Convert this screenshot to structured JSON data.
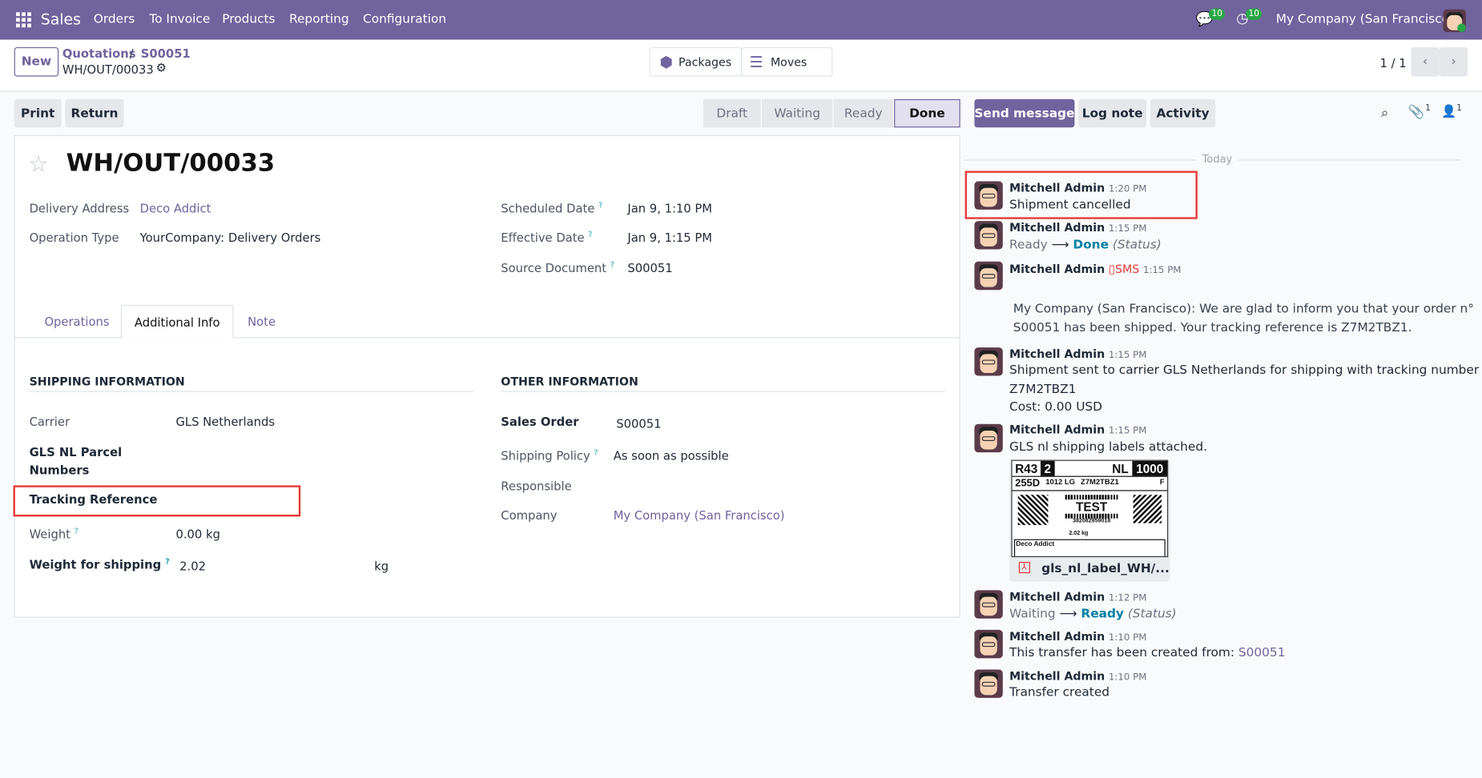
{
  "navbar": {
    "app": "Sales",
    "menu": [
      "Orders",
      "To Invoice",
      "Products",
      "Reporting",
      "Configuration"
    ],
    "messages_count": "10",
    "activities_count": "10",
    "company": "My Company (San Francisco)"
  },
  "control_panel": {
    "new_label": "New",
    "breadcrumb": [
      "Quotations",
      "S00051"
    ],
    "record": "WH/OUT/00033",
    "smart_buttons": [
      "Packages",
      "Moves"
    ],
    "pager": "1 / 1"
  },
  "actions": {
    "print": "Print",
    "return": "Return"
  },
  "statusbar": {
    "stages": [
      "Draft",
      "Waiting",
      "Ready",
      "Done"
    ],
    "active": "Done"
  },
  "chatter_buttons": {
    "send": "Send message",
    "log": "Log note",
    "activity": "Activity",
    "attachments": "1",
    "followers": "1"
  },
  "form": {
    "title": "WH/OUT/00033",
    "left": [
      {
        "label": "Delivery Address",
        "value": "Deco Addict"
      },
      {
        "label": "Operation Type",
        "value": "YourCompany: Delivery Orders"
      }
    ],
    "right": [
      {
        "label": "Scheduled Date",
        "value": "Jan 9, 1:10 PM"
      },
      {
        "label": "Effective Date",
        "value": "Jan 9, 1:15 PM"
      },
      {
        "label": "Source Document",
        "value": "S00051"
      }
    ],
    "tabs": [
      "Operations",
      "Additional Info",
      "Note"
    ],
    "shipping": {
      "title": "SHIPPING INFORMATION",
      "carrier_label": "Carrier",
      "carrier": "GLS Netherlands",
      "parcel_label_1": "GLS NL Parcel",
      "parcel_label_2": "Numbers",
      "tracking_label": "Tracking Reference",
      "weight_label": "Weight",
      "weight": "0.00 kg",
      "wfs_label": "Weight for shipping",
      "wfs": "2.02",
      "wfs_unit": "kg"
    },
    "other": {
      "title": "OTHER INFORMATION",
      "so_label": "Sales Order",
      "so": "S00051",
      "policy_label": "Shipping Policy",
      "policy": "As soon as possible",
      "responsible_label": "Responsible",
      "company_label": "Company",
      "company": "My Company (San Francisco)"
    }
  },
  "chatter": {
    "today": "Today",
    "messages": [
      {
        "author": "Mitchell Admin",
        "time": "1:20 PM",
        "body": "Shipment cancelled"
      },
      {
        "author": "Mitchell Admin",
        "time": "1:15 PM",
        "from": "Ready",
        "to": "Done",
        "field": "(Status)"
      },
      {
        "author": "Mitchell Admin",
        "tag": "SMS",
        "time": "1:15 PM",
        "body": "My Company (San Francisco): We are glad to inform you that your order n°",
        "body2": "S00051 has been shipped. Your tracking reference is Z7M2TBZ1."
      },
      {
        "author": "Mitchell Admin",
        "time": "1:15 PM",
        "body": "Shipment sent to carrier GLS Netherlands for shipping with tracking number",
        "body2": "Z7M2TBZ1",
        "body3": "Cost: 0.00 USD"
      },
      {
        "author": "Mitchell Admin",
        "time": "1:15 PM",
        "body": "GLS nl shipping labels attached.",
        "attachment": "gls_nl_label_WH/...",
        "label": {
          "r": "R43",
          "n": "2",
          "c": "NL",
          "z": "1000",
          "a": "255D",
          "pc": "1012 LG",
          "t": "Z7M2TBZ1",
          "f": "F",
          "test": "TEST",
          "num": "382082959018",
          "w": "2.02 kg",
          "to": "Deco Addict"
        }
      },
      {
        "author": "Mitchell Admin",
        "time": "1:12 PM",
        "from": "Waiting",
        "to": "Ready",
        "field": "(Status)"
      },
      {
        "author": "Mitchell Admin",
        "time": "1:10 PM",
        "body": "This transfer has been created from:",
        "link": "S00051"
      },
      {
        "author": "Mitchell Admin",
        "time": "1:10 PM",
        "body": "Transfer created"
      }
    ]
  }
}
